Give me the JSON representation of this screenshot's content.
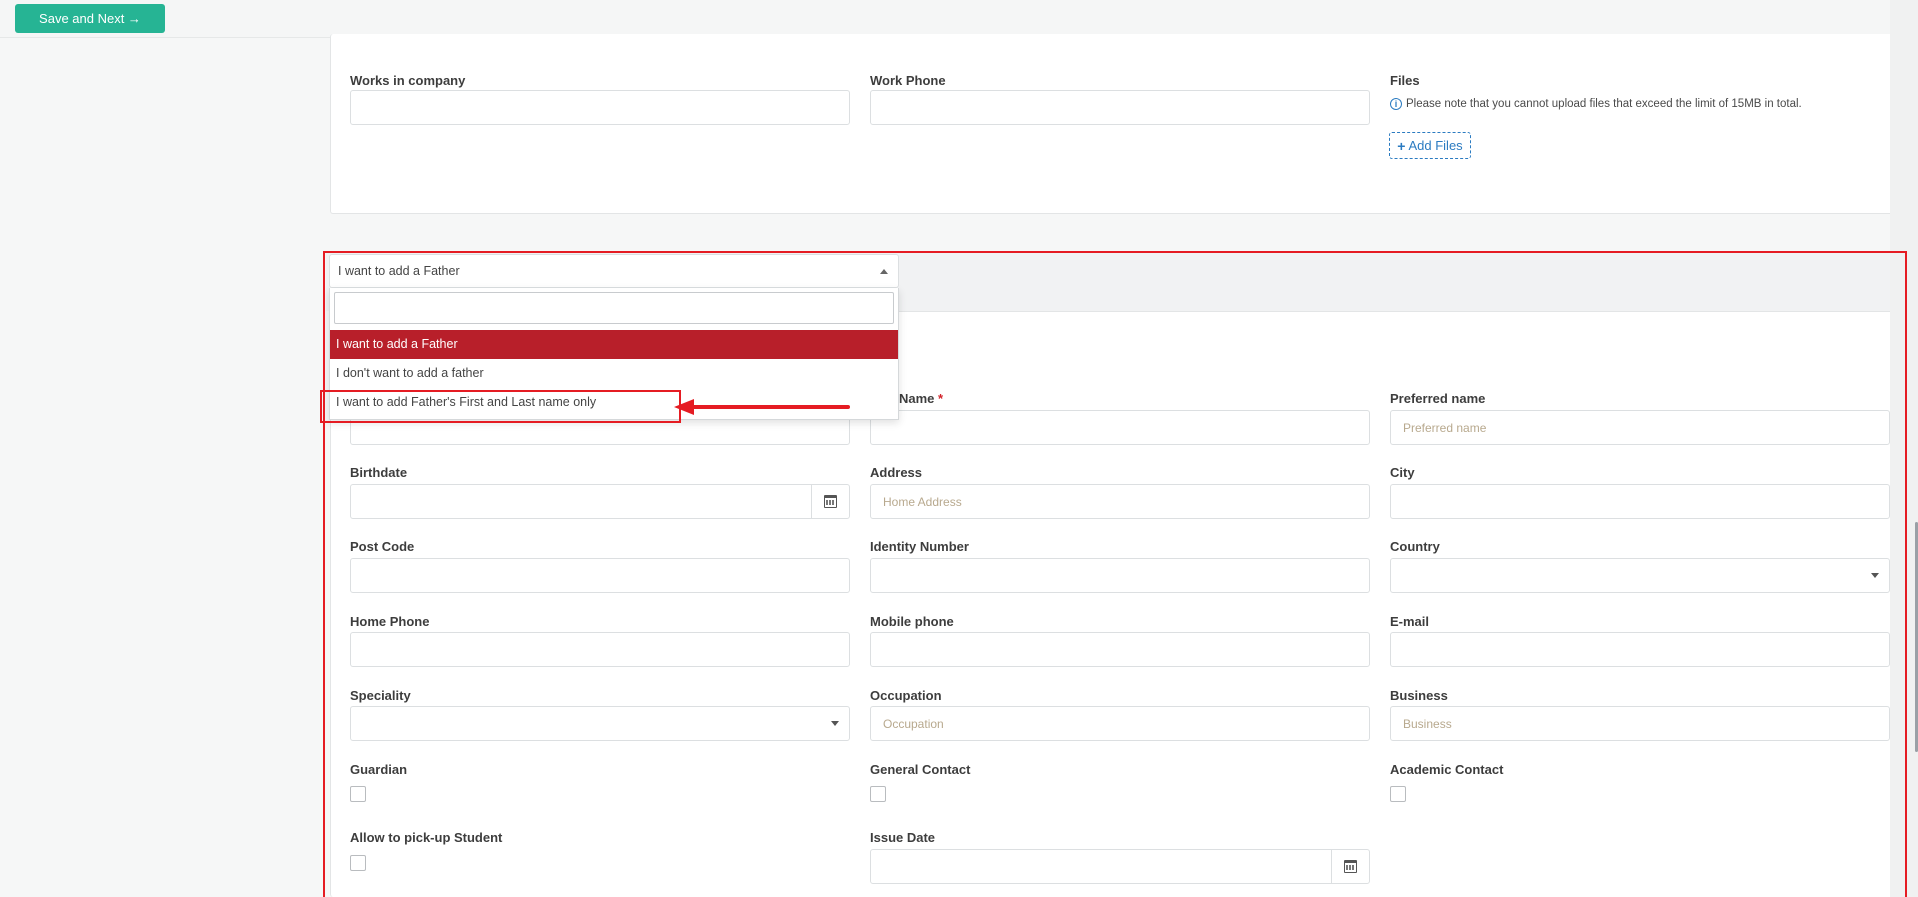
{
  "toolbar": {
    "save_next_label": "Save and Next →"
  },
  "top_section": {
    "works_in_company_label": "Works in company",
    "work_phone_label": "Work Phone",
    "files_label": "Files",
    "files_note": "Please note that you cannot upload files that exceed the limit of 15MB in total.",
    "add_files_label": "Add Files"
  },
  "father_select": {
    "selected": "I want to add a Father",
    "search_value": "",
    "options": [
      "I want to add a Father",
      "I don't want to add a father",
      "I want to add Father's First and Last name only"
    ]
  },
  "form": {
    "last_name_label": "Name",
    "preferred_name_label": "Preferred name",
    "preferred_name_placeholder": "Preferred name",
    "birthdate_label": "Birthdate",
    "address_label": "Address",
    "address_placeholder": "Home Address",
    "city_label": "City",
    "post_code_label": "Post Code",
    "identity_number_label": "Identity Number",
    "country_label": "Country",
    "home_phone_label": "Home Phone",
    "mobile_phone_label": "Mobile phone",
    "email_label": "E-mail",
    "speciality_label": "Speciality",
    "occupation_label": "Occupation",
    "occupation_placeholder": "Occupation",
    "business_label": "Business",
    "business_placeholder": "Business",
    "guardian_label": "Guardian",
    "general_contact_label": "General Contact",
    "academic_contact_label": "Academic Contact",
    "allow_pickup_label": "Allow to pick-up Student",
    "issue_date_label": "Issue Date"
  },
  "colors": {
    "save_button": "#26b494",
    "selected_option": "#b81f2a",
    "annotation": "#e51c23",
    "link": "#2b7bc1"
  }
}
